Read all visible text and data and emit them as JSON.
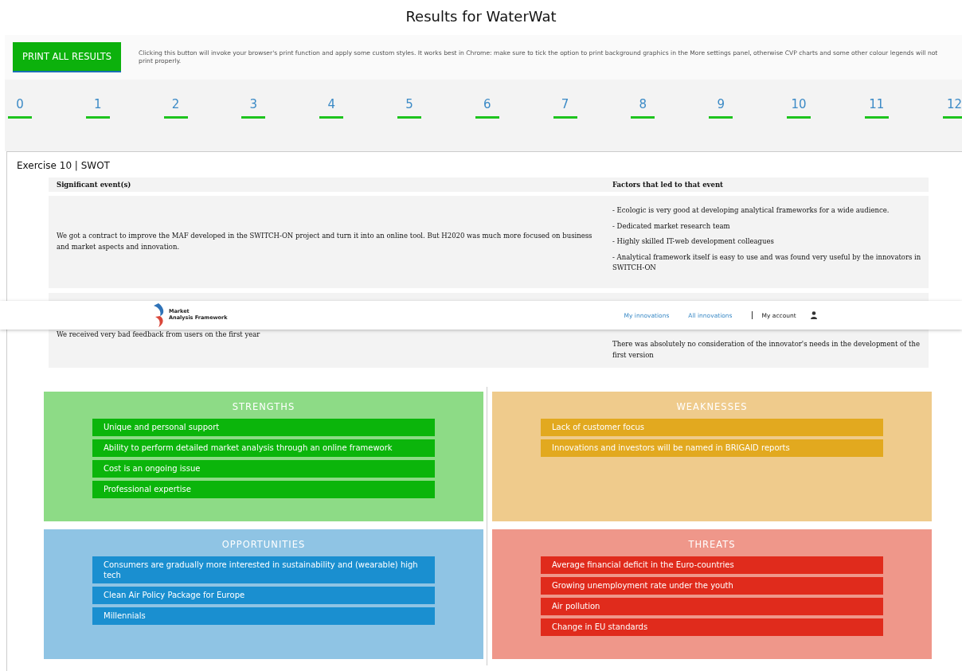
{
  "title": "Results for WaterWat",
  "print": {
    "button": "PRINT ALL RESULTS",
    "note": "Clicking this button will invoke your browser's print function and apply some custom styles. It works best in Chrome: make sure to tick the option to print background graphics in the More settings panel, otherwise CVP charts and some other colour legends will not print properly."
  },
  "exercise_tabs": [
    "0",
    "1",
    "2",
    "3",
    "4",
    "5",
    "6",
    "7",
    "8",
    "9",
    "10",
    "11",
    "12"
  ],
  "exercise": {
    "title": "Exercise 10 | SWOT",
    "columns": [
      "Significant event(s)",
      "Factors that led to that event"
    ],
    "rows": [
      {
        "event": "We got a contract to improve the MAF developed in the SWITCH-ON project and turn it into an online tool. But H2020 was much more focused on business and market aspects and innovation.",
        "factors": [
          "- Ecologic is very good at developing analytical frameworks for a wide audience.",
          "- Dedicated market research team",
          "- Highly skilled IT-web development colleagues",
          "- Analytical framework itself is easy to use and was found very useful by the innovators in SWITCH-ON"
        ]
      },
      {
        "event": "We received very bad feedback from users on the first year",
        "factors": [
          "There was absolutely no consideration of the innovator's needs in the development of the first version"
        ]
      }
    ],
    "swot": [
      {
        "kind": "strengths",
        "title": "STRENGTHS",
        "items": [
          "Unique and personal support",
          "Ability to perform detailed market analysis through an online framework",
          "Cost is an ongoing issue",
          "Professional expertise"
        ]
      },
      {
        "kind": "weaknesses",
        "title": "WEAKNESSES",
        "items": [
          "Lack of customer focus",
          "Innovations and investors will be named in BRIGAID reports"
        ]
      },
      {
        "kind": "opportunities",
        "title": "OPPORTUNITIES",
        "items": [
          "Consumers are gradually more interested in sustainability and (wearable) high tech",
          "Clean Air Policy Package for Europe",
          "Millennials"
        ]
      },
      {
        "kind": "threats",
        "title": "THREATS",
        "items": [
          "Average financial deficit in the Euro-countries",
          "Growing unemployment rate under the youth",
          "Air pollution",
          "Change in EU standards"
        ]
      }
    ]
  },
  "navbar": {
    "logo": [
      "Market",
      "Analysis Framework"
    ],
    "links": [
      "My innovations",
      "All innovations"
    ],
    "account": "My account"
  }
}
